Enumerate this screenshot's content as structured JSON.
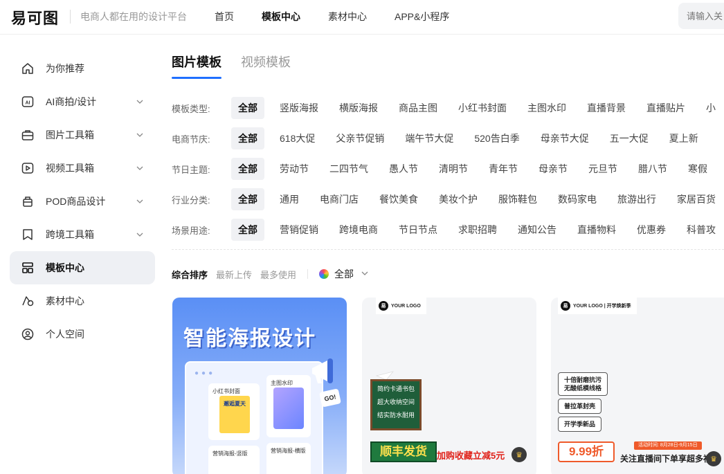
{
  "header": {
    "logo": "易可图",
    "tagline": "电商人都在用的设计平台",
    "nav": [
      "首页",
      "模板中心",
      "素材中心",
      "APP&小程序"
    ],
    "active_nav": "模板中心",
    "search_placeholder": "请输入关"
  },
  "sidebar": {
    "items": [
      {
        "label": "为你推荐",
        "icon": "home-icon"
      },
      {
        "label": "AI商拍/设计",
        "icon": "ai-icon"
      },
      {
        "label": "图片工具箱",
        "icon": "toolbox-icon"
      },
      {
        "label": "视频工具箱",
        "icon": "video-icon"
      },
      {
        "label": "POD商品设计",
        "icon": "bag-icon"
      },
      {
        "label": "跨境工具箱",
        "icon": "bookmark-icon"
      },
      {
        "label": "模板中心",
        "icon": "grid-icon"
      },
      {
        "label": "素材中心",
        "icon": "shapes-icon"
      },
      {
        "label": "个人空间",
        "icon": "user-icon"
      }
    ]
  },
  "tabs": [
    "图片模板",
    "视频模板"
  ],
  "filters": [
    {
      "label": "模板类型:",
      "options": [
        "全部",
        "竖版海报",
        "横版海报",
        "商品主图",
        "小红书封面",
        "主图水印",
        "直播背景",
        "直播贴片",
        "小"
      ]
    },
    {
      "label": "电商节庆:",
      "options": [
        "全部",
        "618大促",
        "父亲节促销",
        "端午节大促",
        "520告白季",
        "母亲节大促",
        "五一大促",
        "夏上新"
      ]
    },
    {
      "label": "节日主题:",
      "options": [
        "全部",
        "劳动节",
        "二四节气",
        "愚人节",
        "清明节",
        "青年节",
        "母亲节",
        "元旦节",
        "腊八节",
        "寒假"
      ]
    },
    {
      "label": "行业分类:",
      "options": [
        "全部",
        "通用",
        "电商门店",
        "餐饮美食",
        "美妆个护",
        "服饰鞋包",
        "数码家电",
        "旅游出行",
        "家居百货"
      ]
    },
    {
      "label": "场景用途:",
      "options": [
        "全部",
        "营销促销",
        "跨境电商",
        "节日节点",
        "求职招聘",
        "通知公告",
        "直播物料",
        "优惠券",
        "科普攻"
      ]
    }
  ],
  "sort": {
    "options": [
      "综合排序",
      "最新上传",
      "最多使用"
    ],
    "color_label": "全部"
  },
  "cards": {
    "c1": {
      "title": "智能海报设计",
      "mini1": "小红书封面",
      "poster_a": "邂逅夏天",
      "mini2": "主图水印",
      "mini3": "营销海报-竖版",
      "mini4": "营销海报-横版",
      "go": "GO!"
    },
    "c2": {
      "logo": "YOUR LOGO",
      "board": [
        "简约卡通书包",
        "超大收纳空间",
        "结实防水耐用"
      ],
      "brand": "顺丰发货",
      "promo": "加购收藏立减5元"
    },
    "c3": {
      "logo": "YOUR LOGO | 开学焕新季",
      "pills": [
        "十倍耐磨抗污\n无酸纸模线格",
        "普拉革封壳",
        "开学季新品"
      ],
      "price": "9.99折",
      "activity": "活动时间: 8月28日-9月15日",
      "live": "关注直播间下单享超多福"
    }
  }
}
